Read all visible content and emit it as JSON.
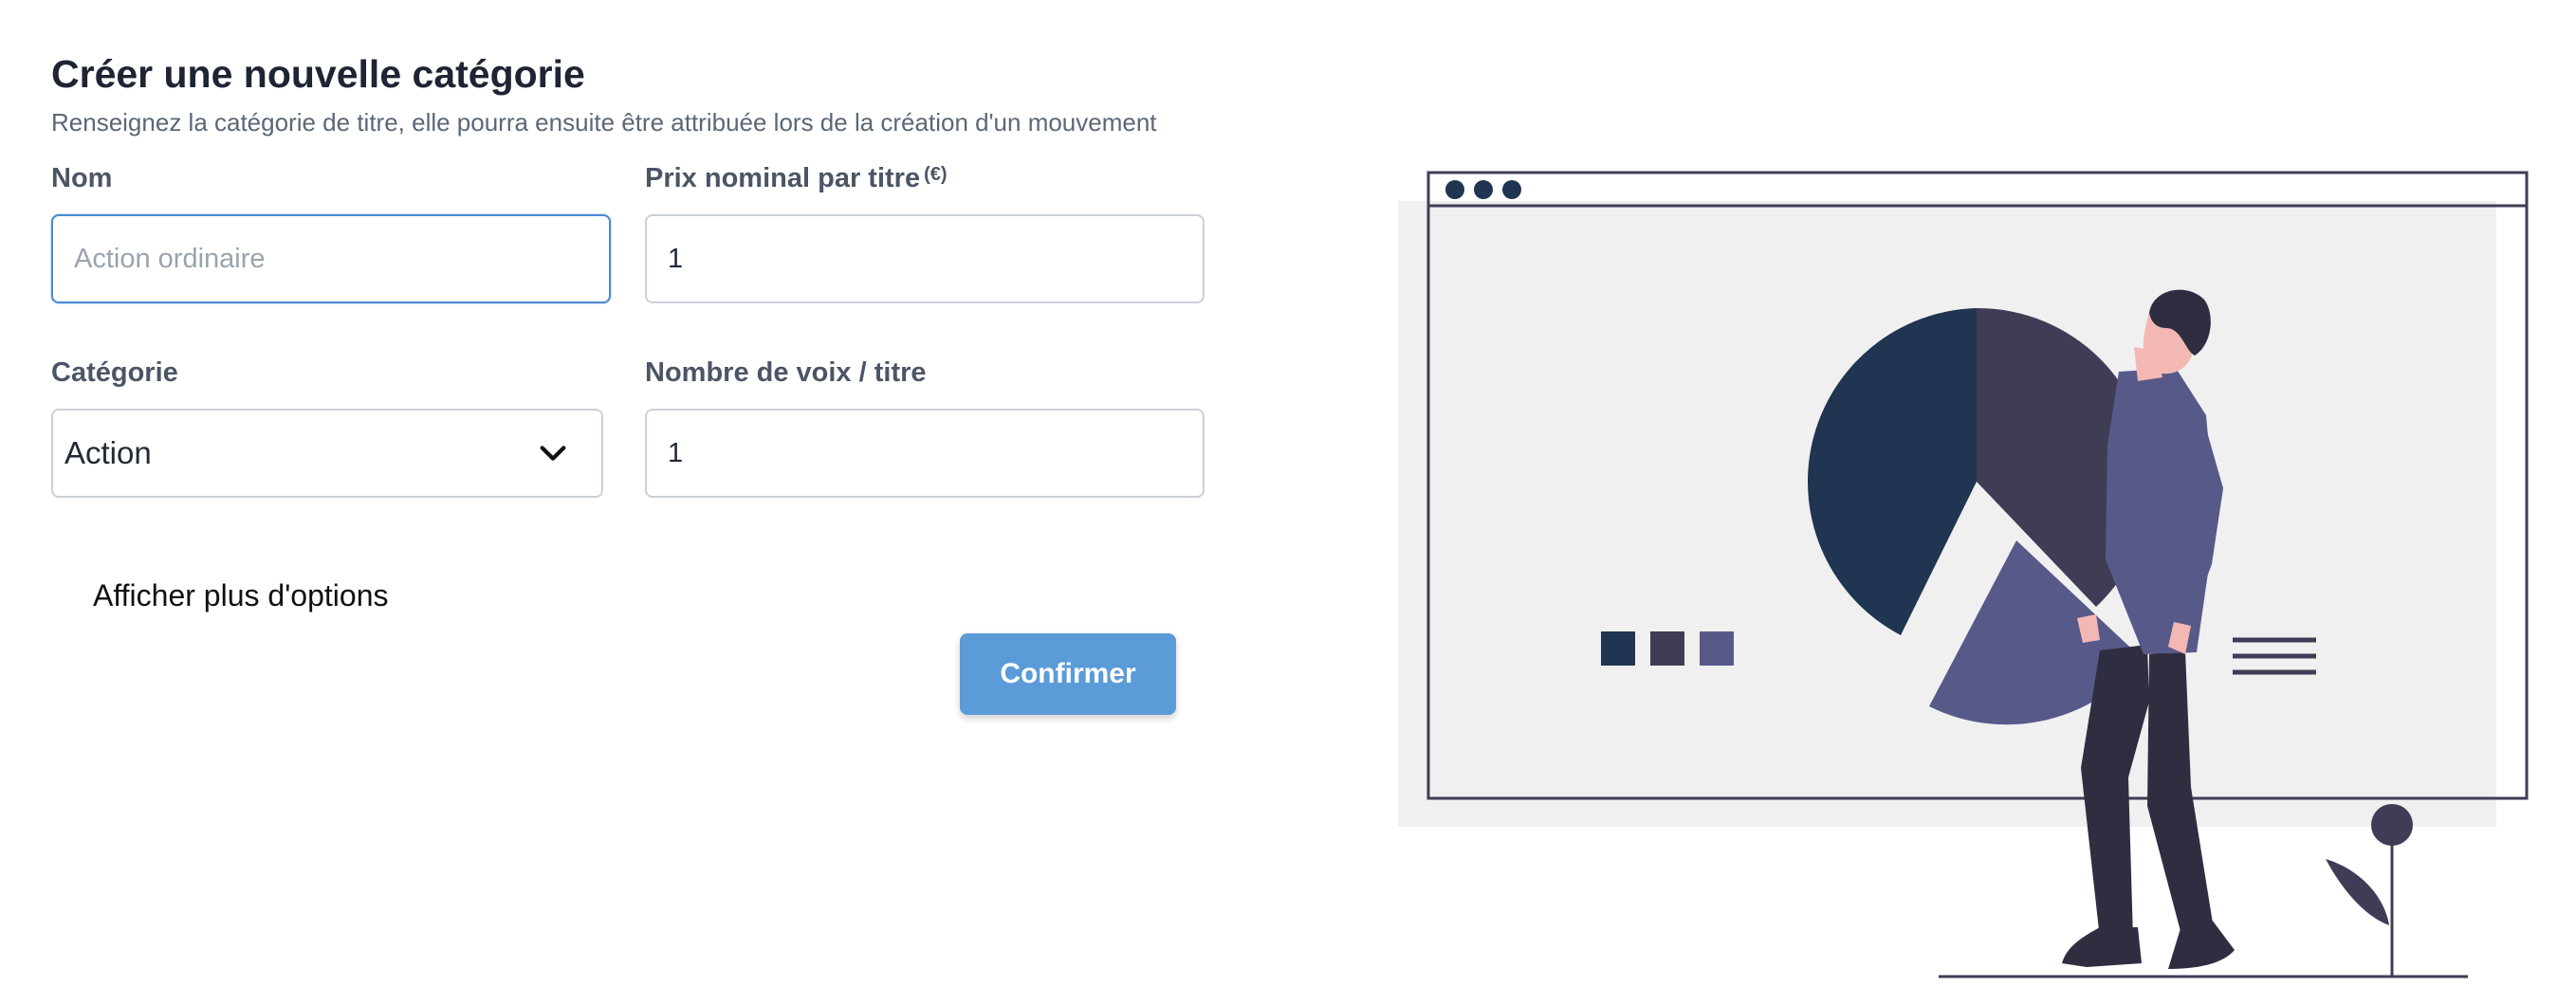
{
  "form": {
    "title": "Créer une nouvelle catégorie",
    "subtitle": "Renseignez la catégorie de titre, elle pourra ensuite être attribuée lors de la création d'un mouvement",
    "fields": {
      "name": {
        "label": "Nom",
        "value": "",
        "placeholder": "Action ordinaire",
        "focused": true
      },
      "nominal_price": {
        "label": "Prix nominal par titre",
        "unit_label": "(€)",
        "value": "1"
      },
      "category": {
        "label": "Catégorie",
        "selected": "Action"
      },
      "votes": {
        "label": "Nombre de voix / titre",
        "value": "1"
      }
    },
    "more_options_label": "Afficher plus d'options",
    "confirm_label": "Confirmer"
  },
  "colors": {
    "accent": "#5b9bd8",
    "focus_border": "#4a8bd2",
    "navy": "#1f3551",
    "slate": "#3f3d56",
    "purple": "#575a89",
    "panel_bg": "#f0f0f0"
  },
  "icons": {
    "select_caret": "chevron-down-icon",
    "illustration": "person-viewing-pie-chart-illustration"
  }
}
